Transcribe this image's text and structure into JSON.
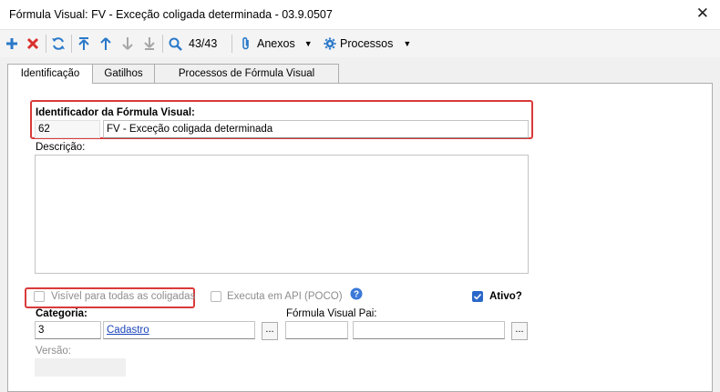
{
  "window": {
    "title": "Fórmula Visual: FV - Exceção coligada determinada - 03.9.0507"
  },
  "toolbar": {
    "record_position": "43/43",
    "annexes_label": "Anexos",
    "processes_label": "Processos"
  },
  "tabs": [
    {
      "label": "Identificação"
    },
    {
      "label": "Gatilhos"
    },
    {
      "label": "Processos de Fórmula Visual"
    }
  ],
  "form": {
    "identifier_label": "Identificador da Fórmula Visual:",
    "identifier_code": "62",
    "identifier_name": "FV - Exceção coligada determinada",
    "description_label": "Descrição:",
    "description_value": "",
    "visible_all_label": "Visível para todas as coligadas",
    "visible_all_checked": false,
    "api_label": "Executa em API (POCO)",
    "api_checked": false,
    "active_label": "Ativo?",
    "active_checked": true,
    "category_label": "Categoria:",
    "category_code": "3",
    "category_name": "Cadastro",
    "parent_label": "Fórmula Visual Pai:",
    "parent_code": "",
    "parent_name": "",
    "version_label": "Versão:",
    "version_value": "",
    "lookup_button": "..."
  },
  "colors": {
    "accent": "#2a67c9",
    "highlight": "#d93a3a",
    "add_icon": "#2a79c9",
    "delete_icon": "#d9302c"
  }
}
